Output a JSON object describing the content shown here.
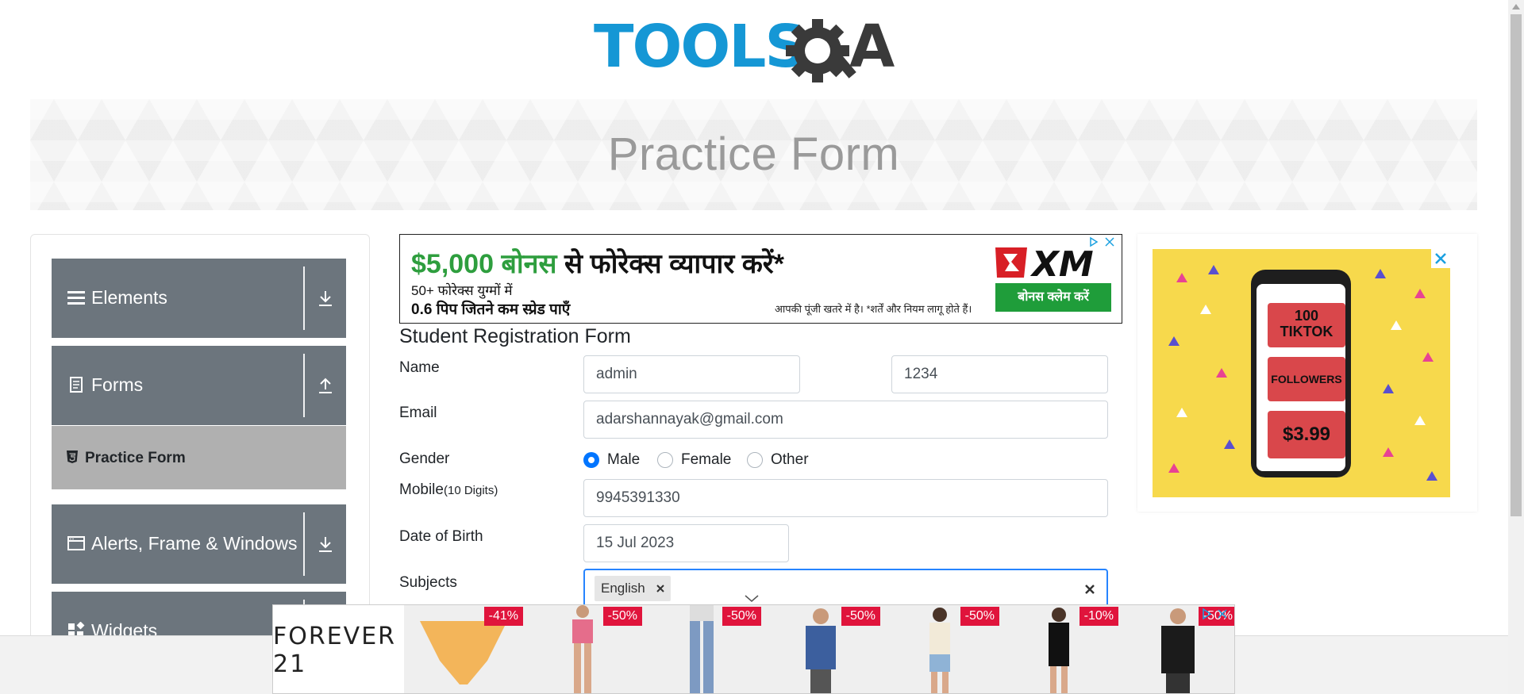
{
  "logo": {
    "text": "TOOLSQA",
    "colors": {
      "tools": "#1597d5",
      "qa": "#3a3a3a"
    }
  },
  "banner": {
    "title": "Practice Form"
  },
  "sidebar": {
    "groups": [
      {
        "label": "Elements",
        "icon": "menu-icon",
        "arrow": "download-arrow-icon"
      },
      {
        "label": "Forms",
        "icon": "document-icon",
        "arrow": "upload-arrow-icon"
      },
      {
        "label": "Alerts, Frame & Windows",
        "icon": "window-icon",
        "arrow": "download-arrow-icon"
      },
      {
        "label": "Widgets",
        "icon": "widgets-icon",
        "arrow": "download-arrow-icon"
      }
    ],
    "active_item": {
      "label": "Practice Form",
      "icon": "html5-icon"
    }
  },
  "top_ad": {
    "amount": "$5,000 बोनस",
    "headline_rest": " से फोरेक्स व्यापार करें*",
    "line1": "50+ फोरेक्स युग्मों में",
    "line2": "0.6 पिप जितने कम स्प्रेड पाएँ",
    "risk": "आपकी पूंजी खतरे में है। *शर्तें और नियम लागू होते हैं।",
    "brand": "XM",
    "cta": "बोनस क्लेम करें"
  },
  "form": {
    "title": "Student Registration Form",
    "name_label": "Name",
    "first_name": "admin",
    "last_name": "1234",
    "email_label": "Email",
    "email": "adarshannayak@gmail.com",
    "gender_label": "Gender",
    "genders": [
      "Male",
      "Female",
      "Other"
    ],
    "gender_selected": "Male",
    "mobile_label": "Mobile",
    "mobile_hint": "(10 Digits)",
    "mobile": "9945391330",
    "dob_label": "Date of Birth",
    "dob": "15 Jul 2023",
    "subjects_label": "Subjects",
    "subjects": [
      "English"
    ]
  },
  "right_ad": {
    "line1": "100",
    "line2": "TIKTOK",
    "line3": "FOLLOWERS",
    "price": "$3.99"
  },
  "bottom_ad": {
    "brand": "FOREVER 21",
    "discounts": [
      "-41%",
      "-50%",
      "-50%",
      "-50%",
      "-50%",
      "-10%",
      "-50%"
    ]
  }
}
